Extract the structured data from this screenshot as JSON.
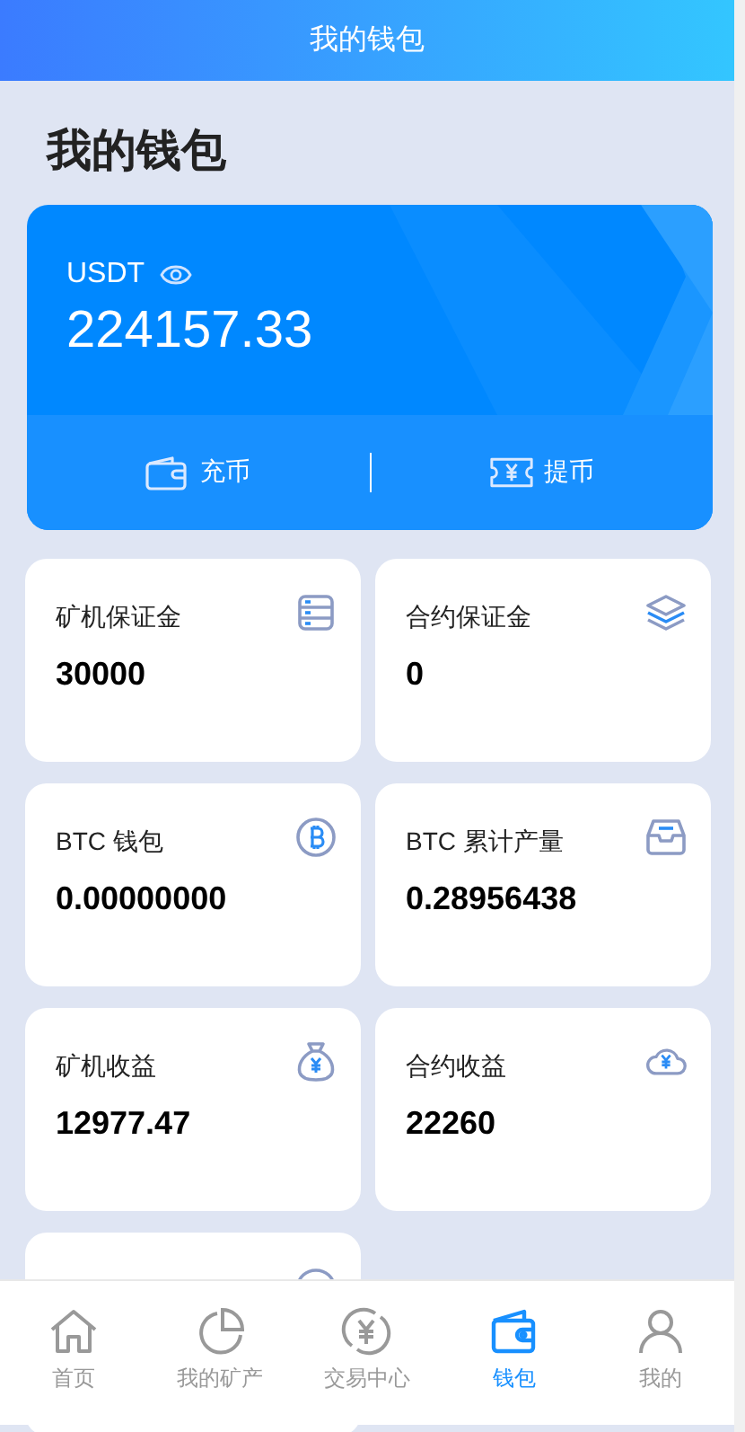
{
  "header": {
    "title": "我的钱包"
  },
  "page_title": "我的钱包",
  "balance": {
    "currency": "USDT",
    "amount": "224157.33",
    "actions": [
      {
        "kind": "deposit",
        "label": "充币"
      },
      {
        "kind": "withdraw",
        "label": "提币"
      }
    ]
  },
  "cards": [
    {
      "kind": "server",
      "label": "矿机保证金",
      "value": "30000"
    },
    {
      "kind": "layers",
      "label": "合约保证金",
      "value": "0"
    },
    {
      "kind": "bitcoin",
      "label": "BTC 钱包",
      "value": "0.00000000"
    },
    {
      "kind": "inbox",
      "label": "BTC 累计产量",
      "value": "0.28956438"
    },
    {
      "kind": "moneybag",
      "label": "矿机收益",
      "value": "12977.47"
    },
    {
      "kind": "cloud",
      "label": "合约收益",
      "value": "22260"
    },
    {
      "kind": "coin"
    }
  ],
  "tabbar": [
    {
      "kind": "home",
      "label": "首页",
      "selected": false
    },
    {
      "kind": "pie",
      "label": "我的矿产",
      "selected": false
    },
    {
      "kind": "exchange",
      "label": "交易中心",
      "selected": false
    },
    {
      "kind": "wallet",
      "label": "钱包",
      "selected": true
    },
    {
      "kind": "user",
      "label": "我的",
      "selected": false
    }
  ]
}
